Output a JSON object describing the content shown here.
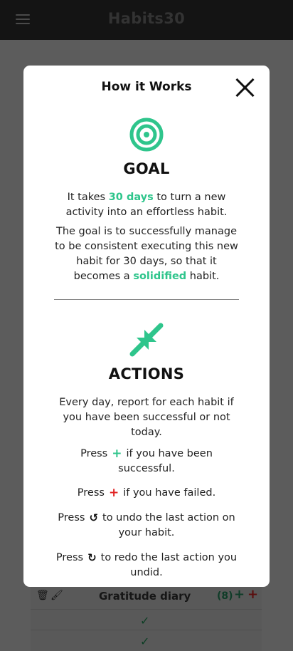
{
  "app": {
    "title": "Habits30"
  },
  "background": {
    "habit_title": "Gratitude diary",
    "habit_count": "(8)",
    "plus": "+",
    "check": "✓"
  },
  "modal": {
    "title": "How it Works",
    "goal": {
      "heading": "GOAL",
      "p1_before": "It takes ",
      "p1_highlight": "30 days",
      "p1_after": " to turn a new activity into an effortless habit.",
      "p2_before": "The goal is to successfully manage to be consistent executing this new habit for 30 days, so that it becomes a ",
      "p2_highlight": "solidified",
      "p2_after": " habit."
    },
    "actions": {
      "heading": "ACTIONS",
      "intro": "Every day, report for each habit if you have been successful or not today.",
      "press": "Press",
      "success_text": "if you have been successful.",
      "fail_text": "if you have failed.",
      "undo_text": "to undo the last action on your habit.",
      "redo_text": "to redo the last action you undid."
    }
  },
  "colors": {
    "accent": "#2fc58c",
    "danger": "#e02222"
  },
  "icons": [
    "menu-icon",
    "close-icon",
    "target-icon",
    "arrows-inward-icon",
    "plus-icon",
    "undo-icon",
    "redo-icon",
    "trash-icon",
    "brush-icon",
    "check-icon"
  ]
}
